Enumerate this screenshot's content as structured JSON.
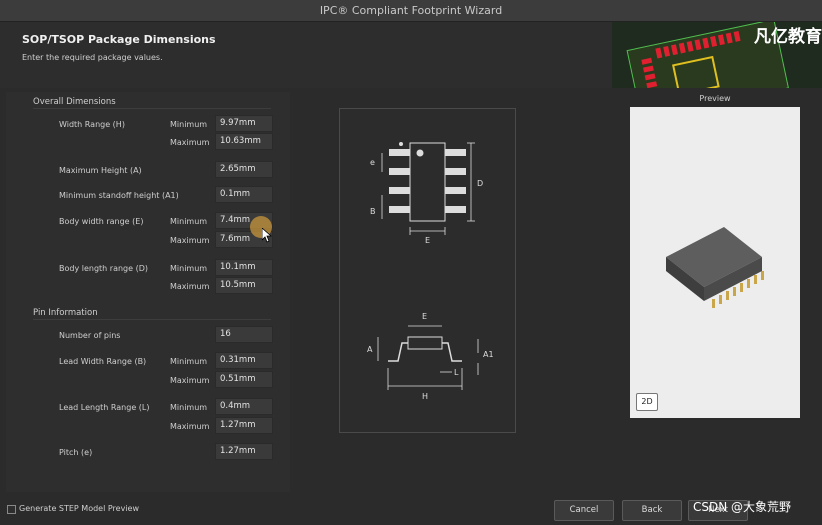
{
  "window": {
    "title": "IPC® Compliant Footprint Wizard"
  },
  "header": {
    "title": "SOP/TSOP Package Dimensions",
    "subtitle": "Enter the required package values.",
    "brand": "凡亿教育"
  },
  "overall": {
    "heading": "Overall Dimensions",
    "width_range": {
      "label": "Width Range (H)",
      "min_label": "Minimum",
      "max_label": "Maximum",
      "min": "9.97mm",
      "max": "10.63mm"
    },
    "max_height": {
      "label": "Maximum Height (A)",
      "value": "2.65mm"
    },
    "standoff": {
      "label": "Minimum standoff height (A1)",
      "value": "0.1mm"
    },
    "body_width": {
      "label": "Body width range (E)",
      "min_label": "Minimum",
      "max_label": "Maximum",
      "min": "7.4mm",
      "max": "7.6mm"
    },
    "body_length": {
      "label": "Body length range (D)",
      "min_label": "Minimum",
      "max_label": "Maximum",
      "min": "10.1mm",
      "max": "10.5mm"
    }
  },
  "pins": {
    "heading": "Pin Information",
    "count": {
      "label": "Number of pins",
      "value": "16"
    },
    "lead_width": {
      "label": "Lead Width Range (B)",
      "min_label": "Minimum",
      "max_label": "Maximum",
      "min": "0.31mm",
      "max": "0.51mm"
    },
    "lead_length": {
      "label": "Lead Length Range (L)",
      "min_label": "Minimum",
      "max_label": "Maximum",
      "min": "0.4mm",
      "max": "1.27mm"
    },
    "pitch": {
      "label": "Pitch (e)",
      "value": "1.27mm"
    }
  },
  "diagram": {
    "top_labels": {
      "e": "e",
      "b": "B",
      "d": "D",
      "e_width": "E"
    },
    "side_labels": {
      "e": "E",
      "a": "A",
      "a1": "A1",
      "l": "L",
      "h": "H"
    }
  },
  "preview": {
    "label": "Preview",
    "mode_button": "2D"
  },
  "footer": {
    "step_checkbox_label": "Generate STEP Model Preview",
    "step_checked": false,
    "cancel": "Cancel",
    "back": "Back",
    "next": "Next",
    "watermark": "CSDN @大象荒野"
  }
}
